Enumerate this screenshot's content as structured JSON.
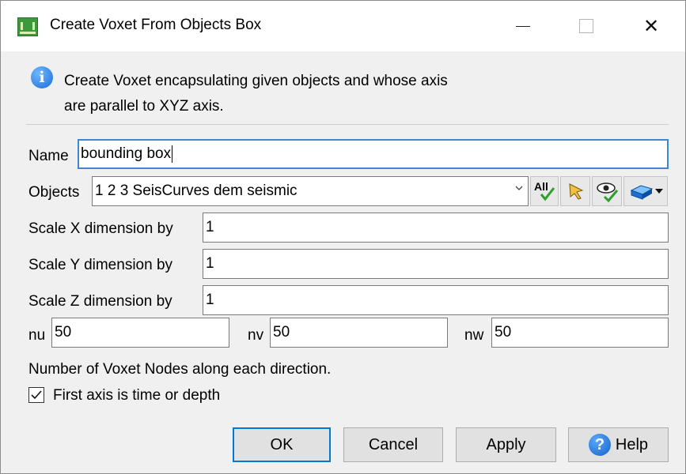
{
  "window": {
    "title": "Create Voxet From Objects Box",
    "icon": "voxet-app-icon",
    "controls": {
      "minimize": "—",
      "close": "✕"
    }
  },
  "info": {
    "icon": "info-icon",
    "line1": "Create Voxet encapsulating given objects and whose axis",
    "line2": "are parallel to XYZ axis."
  },
  "form": {
    "name_label": "Name",
    "name_value": "bounding box",
    "objects_label": "Objects",
    "objects_value": "1 2 3 SeisCurves dem seismic",
    "tools": {
      "all_label": "All",
      "icons": [
        "select-all-icon",
        "pick-cursor-icon",
        "visible-eye-icon",
        "object-type-icon",
        "dropdown-arrow-icon"
      ]
    },
    "scale_x_label": "Scale X dimension by",
    "scale_x_value": "1",
    "scale_y_label": "Scale Y dimension by",
    "scale_y_value": "1",
    "scale_z_label": "Scale Z dimension by",
    "scale_z_value": "1",
    "nu_label": "nu",
    "nu_value": "50",
    "nv_label": "nv",
    "nv_value": "50",
    "nw_label": "nw",
    "nw_value": "50",
    "nodes_hint": "Number of Voxet Nodes along each direction.",
    "first_axis_label": "First axis is time or depth",
    "first_axis_checked": true
  },
  "buttons": {
    "ok": "OK",
    "cancel": "Cancel",
    "apply": "Apply",
    "help": "Help"
  },
  "colors": {
    "accent": "#0078d7",
    "focus_border": "#3f86d2",
    "dialog_bg": "#f0f0f0"
  }
}
